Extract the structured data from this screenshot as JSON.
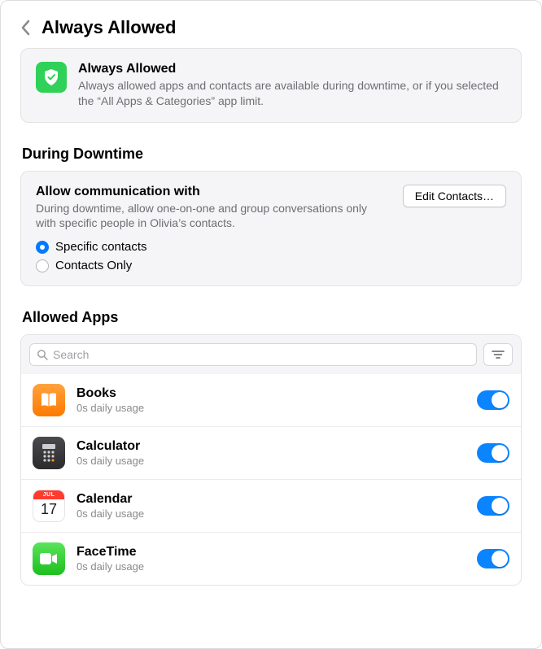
{
  "header": {
    "title": "Always Allowed"
  },
  "summary": {
    "title": "Always Allowed",
    "desc": "Always allowed apps and contacts are available during downtime, or if you selected the “All Apps & Categories” app limit."
  },
  "downtime": {
    "section_title": "During Downtime",
    "comm_title": "Allow communication with",
    "comm_desc": "During downtime, allow one-on-one and group conversations only with specific people in Olivia’s contacts.",
    "edit_label": "Edit Contacts…",
    "options": [
      {
        "label": "Specific contacts",
        "selected": true
      },
      {
        "label": "Contacts Only",
        "selected": false
      }
    ]
  },
  "apps": {
    "section_title": "Allowed Apps",
    "search_placeholder": "Search",
    "items": [
      {
        "name": "Books",
        "usage": "0s daily usage",
        "enabled": true,
        "icon": "books"
      },
      {
        "name": "Calculator",
        "usage": "0s daily usage",
        "enabled": true,
        "icon": "calculator"
      },
      {
        "name": "Calendar",
        "usage": "0s daily usage",
        "enabled": true,
        "icon": "calendar",
        "calendar_month": "JUL",
        "calendar_day": "17"
      },
      {
        "name": "FaceTime",
        "usage": "0s daily usage",
        "enabled": true,
        "icon": "facetime"
      }
    ]
  },
  "colors": {
    "accent": "#007aff",
    "switch": "#0a84ff",
    "success": "#30d158"
  }
}
